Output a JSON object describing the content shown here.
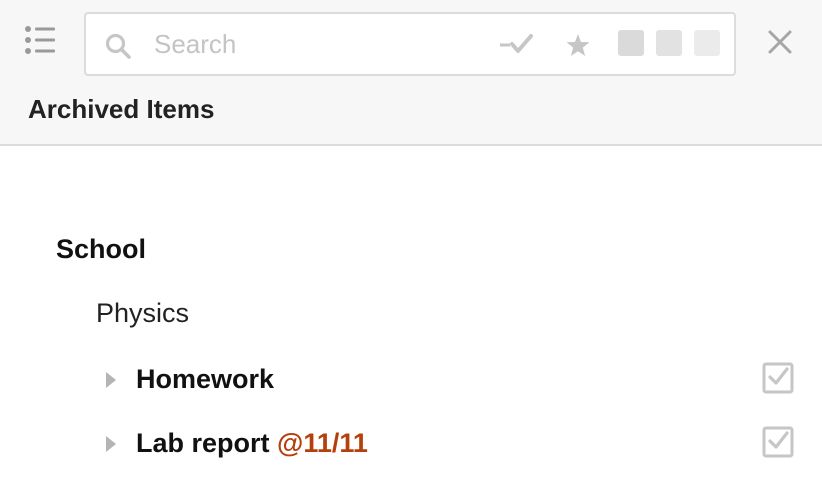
{
  "header": {
    "title": "Archived Items",
    "colors": {
      "background": "#f7f7f7",
      "border": "#dcdcdc"
    }
  },
  "toolbar": {
    "menu_icon": "list-menu-icon",
    "close_icon": "close-icon"
  },
  "search": {
    "placeholder": "Search",
    "value": "",
    "icon": "search-icon",
    "filters": {
      "done_icon": "dash-check-icon",
      "star_icon": "star-icon",
      "color_squares": [
        "#dadada",
        "#e2e2e2",
        "#ebebeb"
      ]
    }
  },
  "tree": {
    "group": "School",
    "subgroup": "Physics",
    "items": [
      {
        "label": "Homework",
        "tag": ""
      },
      {
        "label": "Lab report",
        "tag": "@11/11"
      }
    ]
  },
  "colors": {
    "accent_tag": "#b5400c",
    "icon_gray": "#c6c6c6"
  }
}
